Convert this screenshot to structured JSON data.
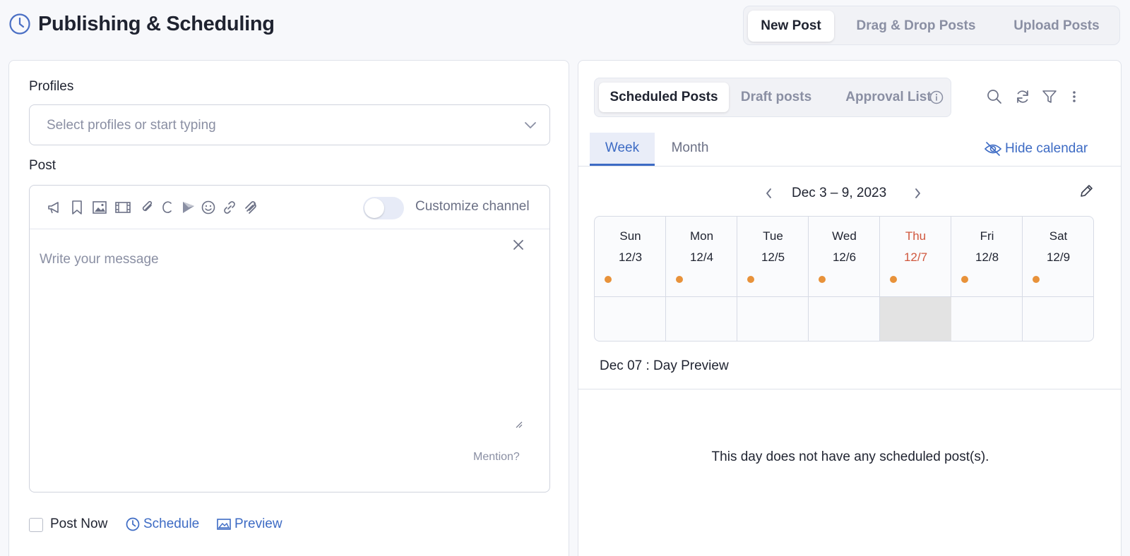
{
  "header": {
    "title": "Publishing & Scheduling",
    "tabs": [
      {
        "label": "New Post",
        "active": true
      },
      {
        "label": "Drag & Drop Posts",
        "active": false
      },
      {
        "label": "Upload Posts",
        "active": false
      }
    ]
  },
  "composer": {
    "profiles_label": "Profiles",
    "profiles_placeholder": "Select profiles or start typing",
    "post_label": "Post",
    "toolbar_icons": [
      "megaphone-icon",
      "bookmark-icon",
      "image-icon",
      "video-icon",
      "attachment-icon",
      "canva-icon",
      "flag-icon",
      "emoji-icon",
      "link-icon",
      "integration-icon"
    ],
    "customize_channel_label": "Customize channel",
    "customize_channel_on": false,
    "message_placeholder": "Write your message",
    "mention_label": "Mention?",
    "post_now_label": "Post Now",
    "post_now_checked": false,
    "schedule_label": "Schedule",
    "preview_label": "Preview"
  },
  "calendar": {
    "tabs": [
      {
        "label": "Scheduled Posts",
        "active": true
      },
      {
        "label": "Draft posts",
        "active": false
      },
      {
        "label": "Approval List",
        "active": false
      }
    ],
    "view_tabs": [
      {
        "label": "Week",
        "active": true
      },
      {
        "label": "Month",
        "active": false
      }
    ],
    "hide_calendar_label": "Hide calendar",
    "range_label": "Dec 3 – 9, 2023",
    "days": [
      {
        "name": "Sun",
        "date": "12/3",
        "today": false
      },
      {
        "name": "Mon",
        "date": "12/4",
        "today": false
      },
      {
        "name": "Tue",
        "date": "12/5",
        "today": false
      },
      {
        "name": "Wed",
        "date": "12/6",
        "today": false
      },
      {
        "name": "Thu",
        "date": "12/7",
        "today": true
      },
      {
        "name": "Fri",
        "date": "12/8",
        "today": false
      },
      {
        "name": "Sat",
        "date": "12/9",
        "today": false
      }
    ],
    "day_preview_title": "Dec 07 : Day Preview",
    "empty_message": "This day does not have any scheduled post(s)."
  },
  "colors": {
    "accent": "#3d6bc4",
    "today": "#d0573d",
    "dot": "#e8923a"
  }
}
